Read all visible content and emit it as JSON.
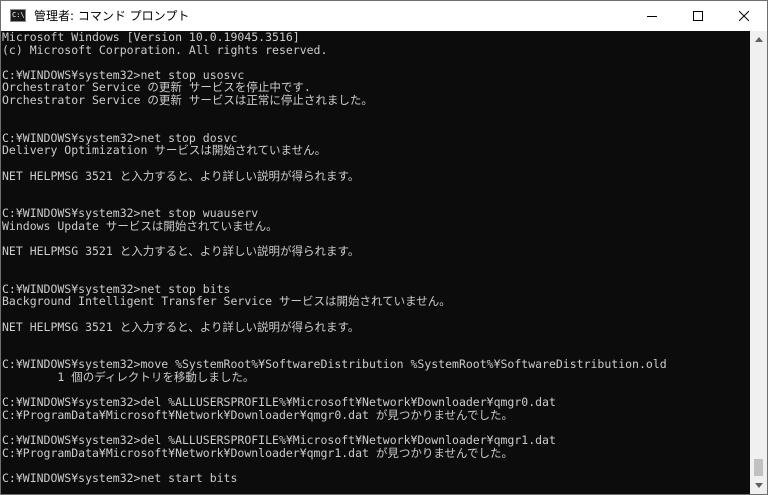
{
  "window": {
    "title": "管理者: コマンド プロンプト",
    "icon": "cmd-app-icon",
    "icon_label": "C:\\"
  },
  "colors": {
    "console_bg": "#0c0c0c",
    "console_fg": "#cccccc",
    "titlebar_bg": "#ffffff"
  },
  "console": {
    "lines": [
      "Microsoft Windows [Version 10.0.19045.3516]",
      "(c) Microsoft Corporation. All rights reserved.",
      "",
      "C:¥WINDOWS¥system32>net stop usosvc",
      "Orchestrator Service の更新 サービスを停止中です.",
      "Orchestrator Service の更新 サービスは正常に停止されました。",
      "",
      "",
      "C:¥WINDOWS¥system32>net stop dosvc",
      "Delivery Optimization サービスは開始されていません。",
      "",
      "NET HELPMSG 3521 と入力すると、より詳しい説明が得られます。",
      "",
      "",
      "C:¥WINDOWS¥system32>net stop wuauserv",
      "Windows Update サービスは開始されていません。",
      "",
      "NET HELPMSG 3521 と入力すると、より詳しい説明が得られます。",
      "",
      "",
      "C:¥WINDOWS¥system32>net stop bits",
      "Background Intelligent Transfer Service サービスは開始されていません。",
      "",
      "NET HELPMSG 3521 と入力すると、より詳しい説明が得られます。",
      "",
      "",
      "C:¥WINDOWS¥system32>move %SystemRoot%¥SoftwareDistribution %SystemRoot%¥SoftwareDistribution.old",
      "        1 個のディレクトリを移動しました。",
      "",
      "C:¥WINDOWS¥system32>del %ALLUSERSPROFILE%¥Microsoft¥Network¥Downloader¥qmgr0.dat",
      "C:¥ProgramData¥Microsoft¥Network¥Downloader¥qmgr0.dat が見つかりませんでした。",
      "",
      "C:¥WINDOWS¥system32>del %ALLUSERSPROFILE%¥Microsoft¥Network¥Downloader¥qmgr1.dat",
      "C:¥ProgramData¥Microsoft¥Network¥Downloader¥qmgr1.dat が見つかりませんでした。",
      "",
      "C:¥WINDOWS¥system32>net start bits"
    ]
  }
}
